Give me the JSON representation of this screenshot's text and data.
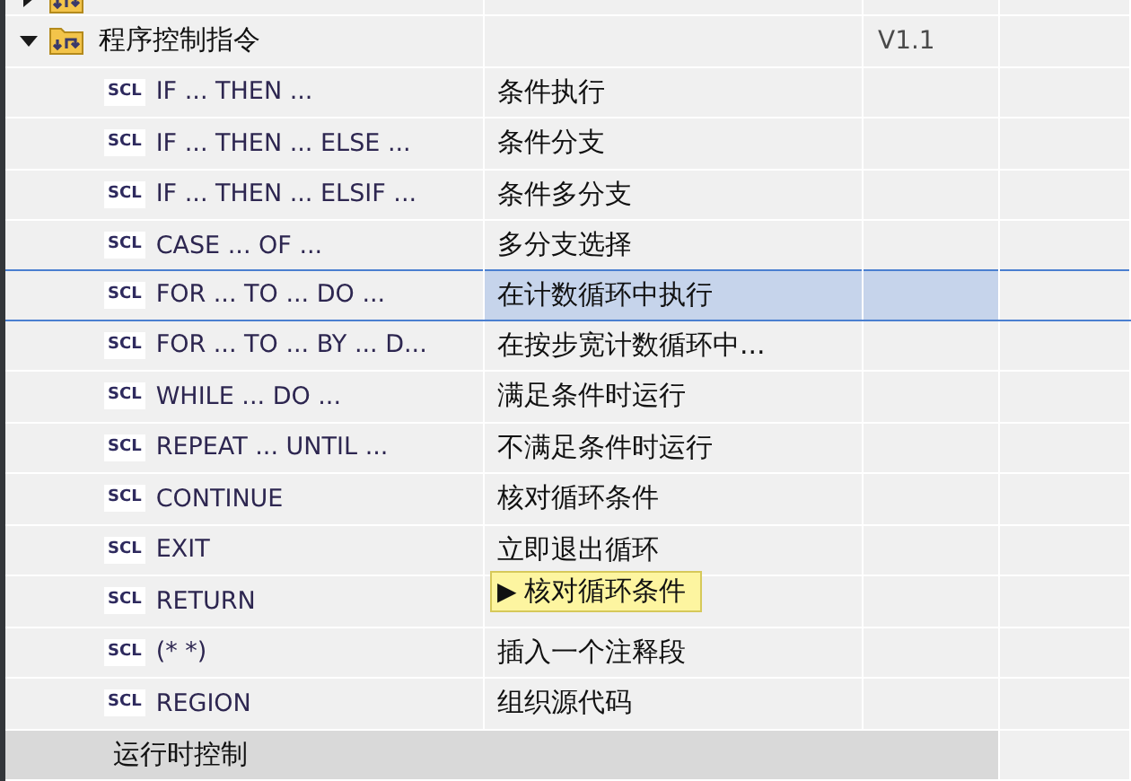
{
  "tree": [
    {
      "kind": "folder",
      "expanded": false
    },
    {
      "kind": "folder",
      "label": "程序控制指令",
      "version": "V1.1",
      "expanded": true,
      "children": [
        {
          "icon_text": "SCL",
          "name": "IF ... THEN ...",
          "description": "条件执行",
          "selected": false
        },
        {
          "icon_text": "SCL",
          "name": "IF ... THEN ... ELSE ...",
          "description": "条件分支",
          "selected": false
        },
        {
          "icon_text": "SCL",
          "name": "IF ... THEN ... ELSIF ...",
          "description": "条件多分支",
          "selected": false
        },
        {
          "icon_text": "SCL",
          "name": "CASE ... OF ...",
          "description": "多分支选择",
          "selected": false
        },
        {
          "icon_text": "SCL",
          "name": "FOR ... TO ... DO ...",
          "description": "在计数循环中执行",
          "selected": true
        },
        {
          "icon_text": "SCL",
          "name": "FOR ... TO ... BY ... D...",
          "description": "在按步宽计数循环中...",
          "selected": false
        },
        {
          "icon_text": "SCL",
          "name": "WHILE ... DO ...",
          "description": "满足条件时运行",
          "selected": false
        },
        {
          "icon_text": "SCL",
          "name": "REPEAT ... UNTIL ...",
          "description": "不满足条件时运行",
          "selected": false
        },
        {
          "icon_text": "SCL",
          "name": "CONTINUE",
          "description": "核对循环条件",
          "selected": false
        },
        {
          "icon_text": "SCL",
          "name": "EXIT",
          "description": "立即退出循环",
          "selected": false
        },
        {
          "icon_text": "SCL",
          "name": "RETURN",
          "selected": false
        },
        {
          "icon_text": "SCL",
          "name": "(*  *)",
          "description": "插入一个注释段",
          "selected": false
        },
        {
          "icon_text": "SCL",
          "name": "REGION",
          "description": "组织源代码",
          "selected": false
        }
      ]
    },
    {
      "kind": "section",
      "label": "运行时控制"
    }
  ],
  "tooltip": {
    "marker": "▶",
    "text": "核对循环条件"
  }
}
